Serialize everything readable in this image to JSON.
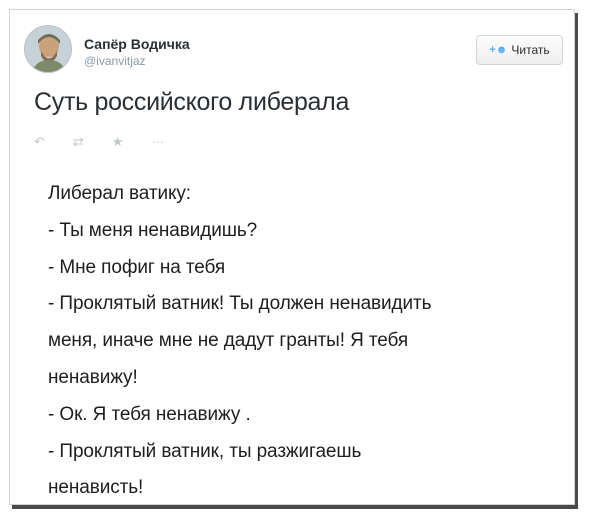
{
  "tweet": {
    "author_name": "Сапёр Водичка",
    "author_handle": "@ivanvitjaz",
    "follow_label": "Читать",
    "follow_icon": "add-user-icon",
    "headline": "Суть российского либерала",
    "actions": [
      {
        "name": "reply",
        "icon": "↶"
      },
      {
        "name": "retweet",
        "icon": "⇄"
      },
      {
        "name": "favorite",
        "icon": "★"
      },
      {
        "name": "more",
        "icon": "···"
      }
    ],
    "lines": [
      "Либерал ватику:",
      "- Ты меня ненавидишь?",
      "- Мне пофиг на тебя",
      "- Проклятый ватник! Ты должен ненавидить",
      "меня, иначе мне не дадут гранты! Я тебя",
      "ненавижу!",
      "- Ок. Я тебя ненавижу .",
      "- Проклятый ватник,  ты разжигаешь",
      "ненависть!"
    ]
  }
}
